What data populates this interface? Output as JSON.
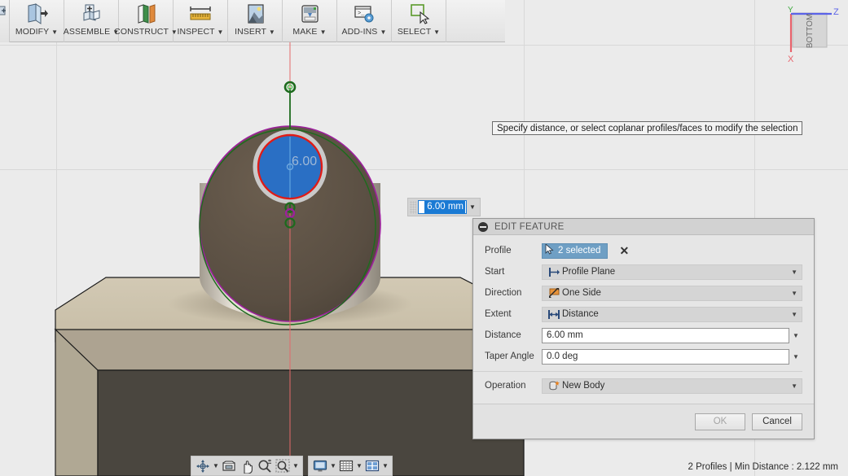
{
  "app": {
    "title": "Fusion 360 Extrude Edit"
  },
  "ribbon": {
    "items": [
      {
        "label": "MODIFY",
        "icon": "modify-icon"
      },
      {
        "label": "ASSEMBLE",
        "icon": "assemble-icon"
      },
      {
        "label": "CONSTRUCT",
        "icon": "construct-icon"
      },
      {
        "label": "INSPECT",
        "icon": "inspect-icon"
      },
      {
        "label": "INSERT",
        "icon": "insert-icon"
      },
      {
        "label": "MAKE",
        "icon": "make-icon"
      },
      {
        "label": "ADD-INS",
        "icon": "add-ins-icon"
      },
      {
        "label": "SELECT",
        "icon": "select-icon"
      }
    ],
    "caret": "▼"
  },
  "viewcube": {
    "face_label": "BOTTOM",
    "axis_x": "X",
    "axis_y": "Y",
    "axis_z": "Z",
    "color_x": "#e8626b",
    "color_y": "#3faa3f",
    "color_z": "#5b63e8"
  },
  "tooltip": {
    "text": "Specify distance, or select coplanar profiles/faces to modify the selection"
  },
  "floating_input": {
    "value": "6.00 mm",
    "caret": "▼",
    "name": "distance-floating-input"
  },
  "canvas": {
    "dimension_label": "6.00",
    "colors": {
      "background": "#ebebeb",
      "gridline": "#d8d8d8",
      "cylinder_body": "#5e5245",
      "cylinder_side": "#d8d2c6",
      "profile_fill": "#2a6fc4",
      "profile_edge": "#e01b16",
      "sketch_green": "#1d6b1d",
      "sketch_magenta": "#9e1f9e",
      "axis_red": "#e46a6a",
      "box_top": "#cdc4ae",
      "box_chamfer": "#ada391",
      "box_front": "#4a463f",
      "box_left": "#b0a894"
    }
  },
  "dialog": {
    "title": "EDIT FEATURE",
    "collapse_icon": "collapse-icon",
    "clear_icon": "clear-selection-icon",
    "rows": [
      {
        "label": "Profile",
        "value": "2 selected",
        "type": "selection",
        "icon": "cursor-arrow-icon"
      },
      {
        "label": "Start",
        "value": "Profile Plane",
        "type": "dropdown",
        "icon": "profile-plane-icon"
      },
      {
        "label": "Direction",
        "value": "One Side",
        "type": "dropdown",
        "icon": "one-side-icon"
      },
      {
        "label": "Extent",
        "value": "Distance",
        "type": "dropdown",
        "icon": "distance-icon"
      },
      {
        "label": "Distance",
        "value": "6.00 mm",
        "type": "text",
        "icon": ""
      },
      {
        "label": "Taper Angle",
        "value": "0.0 deg",
        "type": "text",
        "icon": ""
      },
      {
        "label": "Operation",
        "value": "New Body",
        "type": "dropdown",
        "icon": "new-body-icon"
      }
    ],
    "caret": "▼",
    "ok_label": "OK",
    "cancel_label": "Cancel",
    "ok_enabled": false
  },
  "navbar": {
    "group1": [
      {
        "icon": "orbit-icon",
        "caret": "▼"
      },
      {
        "icon": "look-at-icon",
        "caret": ""
      },
      {
        "icon": "pan-icon",
        "caret": ""
      },
      {
        "icon": "zoom-icon",
        "caret": ""
      },
      {
        "icon": "zoom-window-icon",
        "caret": "▼"
      }
    ],
    "group2": [
      {
        "icon": "display-settings-icon",
        "caret": "▼"
      },
      {
        "icon": "grid-snaps-icon",
        "caret": "▼"
      },
      {
        "icon": "viewports-icon",
        "caret": "▼"
      }
    ]
  },
  "statusbar": {
    "text": "2 Profiles | Min Distance : 2.122 mm"
  }
}
